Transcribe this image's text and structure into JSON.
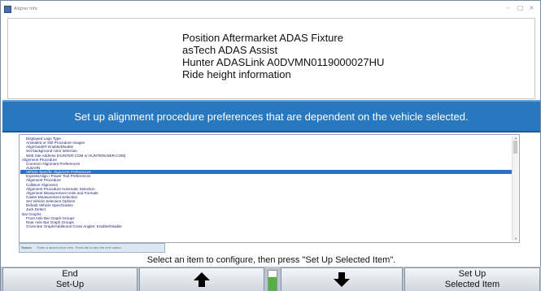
{
  "window": {
    "title": "Aligner Info",
    "controls": [
      "–",
      "□",
      "×"
    ]
  },
  "info": {
    "lines": [
      "Position Aftermarket ADAS Fixture",
      "asTech ADAS Assist",
      "Hunter ADASLink A0DVMN0119000027HU",
      "Ride height information"
    ]
  },
  "banner": {
    "text": "Set up alignment procedure preferences that are dependent on the vehicle selected."
  },
  "list": {
    "items": [
      {
        "label": "Displayed Logo Type",
        "kind": "item",
        "selected": false
      },
      {
        "label": "Animated or Still Procedure Images",
        "kind": "item",
        "selected": false
      },
      {
        "label": "AlignGuide® Enable/Disable",
        "kind": "item",
        "selected": false
      },
      {
        "label": "Set background color selection",
        "kind": "item",
        "selected": false
      },
      {
        "label": "Web Site Address (HUNTER.COM or HUNTERUSER.COM)",
        "kind": "item",
        "selected": false
      },
      {
        "label": "Alignment Procedure",
        "kind": "category",
        "selected": false
      },
      {
        "label": "Common Alignment Preferences",
        "kind": "item",
        "selected": false
      },
      {
        "label": "AutoVIN",
        "kind": "item",
        "selected": false
      },
      {
        "label": "Vehicle Specific Alignment Preferences",
        "kind": "item",
        "selected": true
      },
      {
        "label": "ExpressAlign / Power Tool Preferences",
        "kind": "item",
        "selected": false
      },
      {
        "label": "Alignment Procedure",
        "kind": "item",
        "selected": false
      },
      {
        "label": "Collision Alignment",
        "kind": "item",
        "selected": false
      },
      {
        "label": "Alignment Procedure Automatic Selection",
        "kind": "item",
        "selected": false
      },
      {
        "label": "Alignment Measurement Units and Formats",
        "kind": "item",
        "selected": false
      },
      {
        "label": "Caster Measurement Selection",
        "kind": "item",
        "selected": false
      },
      {
        "label": "Set Vehicle Selection Options",
        "kind": "item",
        "selected": false
      },
      {
        "label": "Default Vehicle Specification",
        "kind": "item",
        "selected": false
      },
      {
        "label": "Jack Detect",
        "kind": "item",
        "selected": false
      },
      {
        "label": "Bar Graphs",
        "kind": "category",
        "selected": false
      },
      {
        "label": "Front Axle Bar Graph Groups",
        "kind": "item",
        "selected": false
      },
      {
        "label": "Rear Axle Bar Graph Groups",
        "kind": "item",
        "selected": false
      },
      {
        "label": "Cross Bar Graph/Additional Cross Angles: Enable/Disable",
        "kind": "item",
        "selected": false
      }
    ]
  },
  "search": {
    "label": "Search",
    "hint": "Enter a search term here. Press tab to see the next match."
  },
  "instruction": {
    "text": "Select an item to configure, then press \"Set Up Selected Item\"."
  },
  "buttons": {
    "end": "End\nSet-Up",
    "up_icon": "arrow-up-icon",
    "down_icon": "arrow-down-icon",
    "setup": "Set Up\nSelected Item"
  },
  "colors": {
    "banner": "#2878c0",
    "selected_row": "#2f6ec0",
    "indicator": "#55b043"
  }
}
